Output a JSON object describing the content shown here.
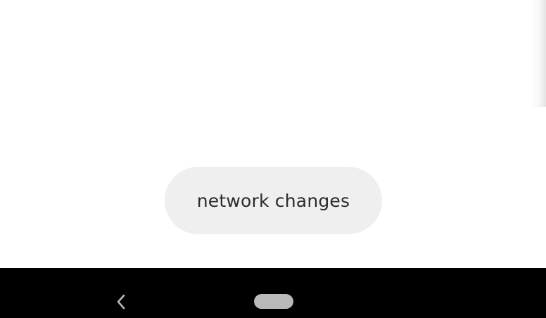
{
  "toast": {
    "message": "network changes"
  },
  "navigation_bar": {
    "back_icon": "chevron-left-icon",
    "home_icon": "home-pill-icon"
  },
  "colors": {
    "background": "#ffffff",
    "toast_background": "#efefef",
    "toast_text": "#2b2b2b",
    "nav_bar": "#000000",
    "nav_icon": "#b9b9b9"
  }
}
